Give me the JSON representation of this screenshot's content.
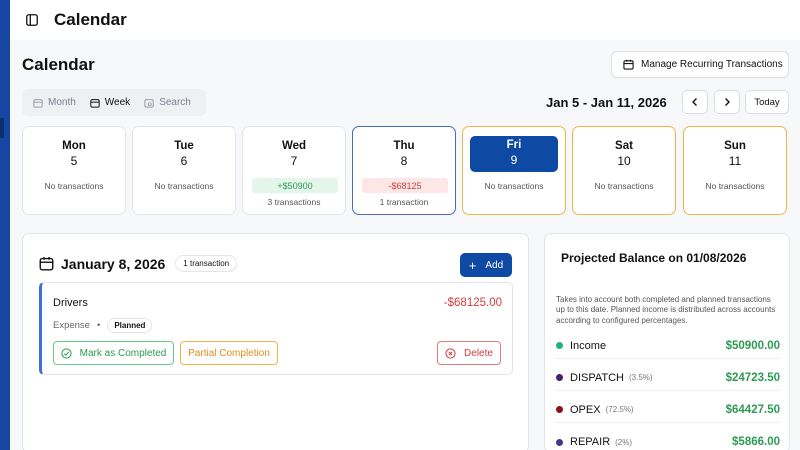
{
  "app": {
    "title": "Calendar"
  },
  "page": {
    "title": "Calendar",
    "manage_button": "Manage Recurring Transactions"
  },
  "view_tabs": [
    {
      "label": "Month",
      "icon": "calendar-icon",
      "active": false
    },
    {
      "label": "Week",
      "icon": "calendar-icon",
      "active": true
    },
    {
      "label": "Search",
      "icon": "search-calendar-icon",
      "active": false
    }
  ],
  "week": {
    "range": "Jan 5 - Jan 11, 2026",
    "today_label": "Today"
  },
  "days": [
    {
      "name": "Mon",
      "num": "5",
      "note": "No transactions"
    },
    {
      "name": "Tue",
      "num": "6",
      "note": "No transactions"
    },
    {
      "name": "Wed",
      "num": "7",
      "amount": "+$50900",
      "note": "3 transactions"
    },
    {
      "name": "Thu",
      "num": "8",
      "amount": "-$68125",
      "note": "1 transaction"
    },
    {
      "name": "Fri",
      "num": "9",
      "note": "No transactions"
    },
    {
      "name": "Sat",
      "num": "10",
      "note": "No transactions"
    },
    {
      "name": "Sun",
      "num": "11",
      "note": "No transactions"
    }
  ],
  "detail": {
    "date": "January 8, 2026",
    "count": "1 transaction",
    "add_label": "Add",
    "transaction": {
      "name": "Drivers",
      "amount": "-$68125.00",
      "type": "Expense",
      "status": "Planned",
      "mark_completed": "Mark as Completed",
      "partial": "Partial Completion",
      "delete": "Delete"
    }
  },
  "projection": {
    "title": "Projected Balance on 01/08/2026",
    "description": "Takes into account both completed and planned transactions up to this date. Planned income is distributed across accounts according to configured percentages.",
    "rows": [
      {
        "name": "Income",
        "pct": "",
        "value": "$50900.00",
        "color": "#22b07d"
      },
      {
        "name": "DISPATCH",
        "pct": "(3.5%)",
        "value": "$24723.50",
        "color": "#4b1d6b"
      },
      {
        "name": "OPEX",
        "pct": "(72.5%)",
        "value": "$64427.50",
        "color": "#8b1212"
      },
      {
        "name": "REPAIR",
        "pct": "(2%)",
        "value": "$5866.00",
        "color": "#3b3b86"
      }
    ]
  },
  "colors": {
    "primary": "#0e4aa3",
    "positive": "#2d9a53",
    "negative": "#d23c3c",
    "warning": "#f0b54a"
  }
}
